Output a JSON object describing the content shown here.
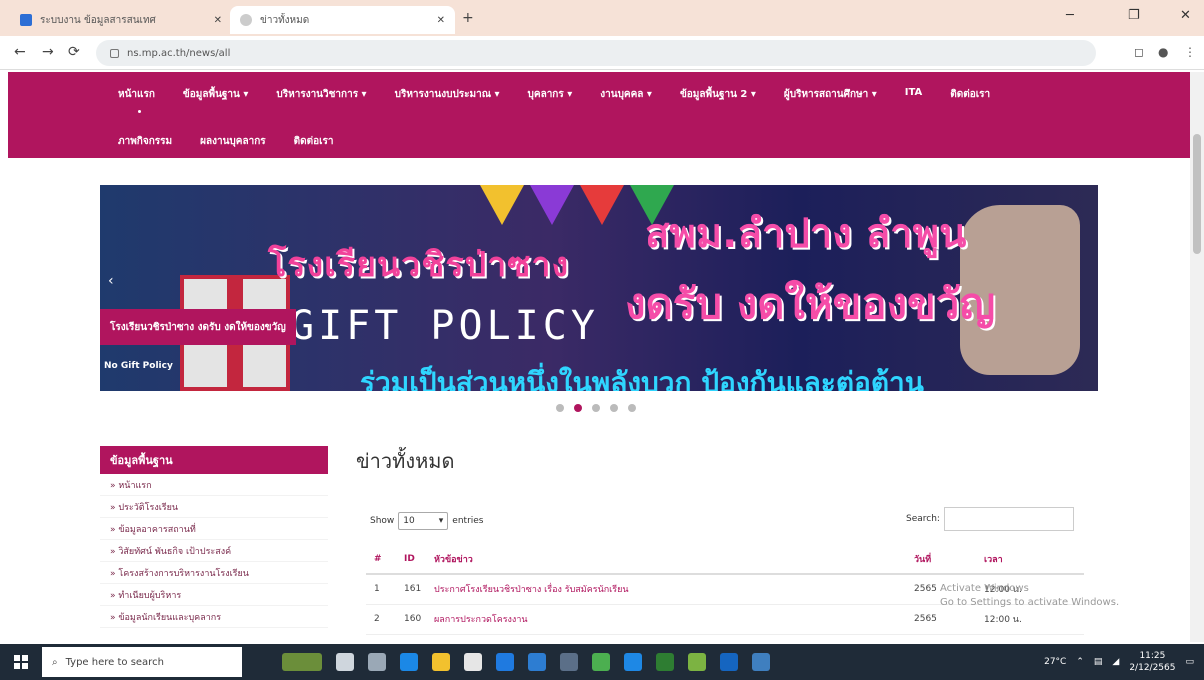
{
  "browser": {
    "tabs": [
      {
        "title": "ระบบงาน ข้อมูลสารสนเทศ",
        "active": false
      },
      {
        "title": "ข่าวทั้งหมด",
        "active": true
      }
    ],
    "url": "ns.mp.ac.th/news/all",
    "new_tab": "+",
    "controls": {
      "minimize": "─",
      "restore": "❐",
      "close": "✕"
    },
    "nav": {
      "back": "←",
      "forward": "→",
      "reload": "⟳"
    }
  },
  "menu": {
    "row1": [
      "หน้าแรก",
      "ข้อมูลพื้นฐาน ▾",
      "บริหารงานวิชาการ ▾",
      "บริหารงานงบประมาณ ▾",
      "บุคลากร ▾",
      "งานบุคคล ▾",
      "ข้อมูลพื้นฐาน 2 ▾",
      "ผู้บริหารสถานศึกษา ▾",
      "ITA",
      "ติดต่อเรา"
    ],
    "row2": [
      "ภาพกิจกรรม",
      "ผลงานบุคลากร",
      "ติดต่อเรา"
    ]
  },
  "banner": {
    "school": "โรงเรียนวชิรป่าซาง",
    "title1": "สพม.ลำปาง ลำพูน",
    "title2": "งดรับ งดให้ของขวัญ",
    "policy": "GIFT POLICY",
    "bottom": "ร่วมเป็นส่วนหนึ่งในพลังบวก ป้องกันและต่อต้าน",
    "caption": "โรงเรียนวชิรป่าซาง งดรับ งดให้ของขวัญ",
    "sub": "No Gift Policy",
    "prev": "‹"
  },
  "carousel": {
    "count": 5,
    "active": 1
  },
  "sidebar": {
    "heading": "ข้อมูลพื้นฐาน",
    "items": [
      "» หน้าแรก",
      "» ประวัติโรงเรียน",
      "» ข้อมูลอาคารสถานที่",
      "» วิสัยทัศน์ พันธกิจ เป้าประสงค์",
      "» โครงสร้างการบริหารงานโรงเรียน",
      "» ทำเนียบผู้บริหาร",
      "» ข้อมูลนักเรียนและบุคลากร"
    ]
  },
  "main": {
    "title": "ข่าวทั้งหมด",
    "show_label": "Show",
    "show_value": "10",
    "entries_label": "entries",
    "search_label": "Search:",
    "columns": [
      "#",
      "ID",
      "หัวข้อข่าว",
      "วันที่",
      "เวลา"
    ],
    "rows": [
      [
        "1",
        "161",
        "ประกาศโรงเรียนวชิรป่าซาง เรื่อง รับสมัครนักเรียน",
        "2565",
        "12:00 น."
      ],
      [
        "2",
        "160",
        "ผลการประกวดโครงงาน",
        "2565",
        "12:00 น."
      ]
    ]
  },
  "watermark": {
    "line1": "Activate Windows",
    "line2": "Go to Settings to activate Windows."
  },
  "taskbar": {
    "search_placeholder": "Type here to search",
    "time": "11:25",
    "date": "2/12/2565",
    "weather": "27°C"
  }
}
